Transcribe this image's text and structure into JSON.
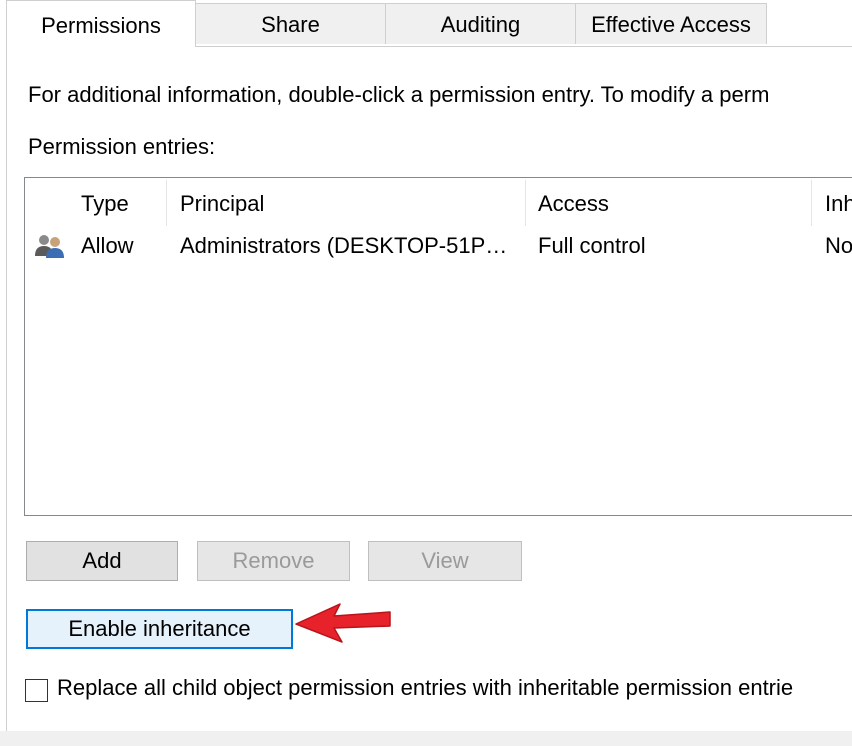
{
  "tabs": [
    {
      "label": "Permissions",
      "active": true
    },
    {
      "label": "Share",
      "active": false
    },
    {
      "label": "Auditing",
      "active": false
    },
    {
      "label": "Effective Access",
      "active": false
    }
  ],
  "info_text": "For additional information, double-click a permission entry. To modify a perm",
  "entries_label": "Permission entries:",
  "table": {
    "headers": {
      "type": "Type",
      "principal": "Principal",
      "access": "Access",
      "inherited": "Inh"
    },
    "rows": [
      {
        "icon": "users-group-icon",
        "type": "Allow",
        "principal": "Administrators (DESKTOP-51P…",
        "access": "Full control",
        "inherited": "No"
      }
    ]
  },
  "buttons": {
    "add": "Add",
    "remove": "Remove",
    "view": "View",
    "enable_inheritance": "Enable inheritance"
  },
  "checkbox": {
    "label": "Replace all child object permission entries with inheritable permission entrie",
    "checked": false
  },
  "annotation": {
    "icon": "red-arrow-icon",
    "color": "#e8222a"
  },
  "colors": {
    "focus_accent": "#0078d7"
  }
}
